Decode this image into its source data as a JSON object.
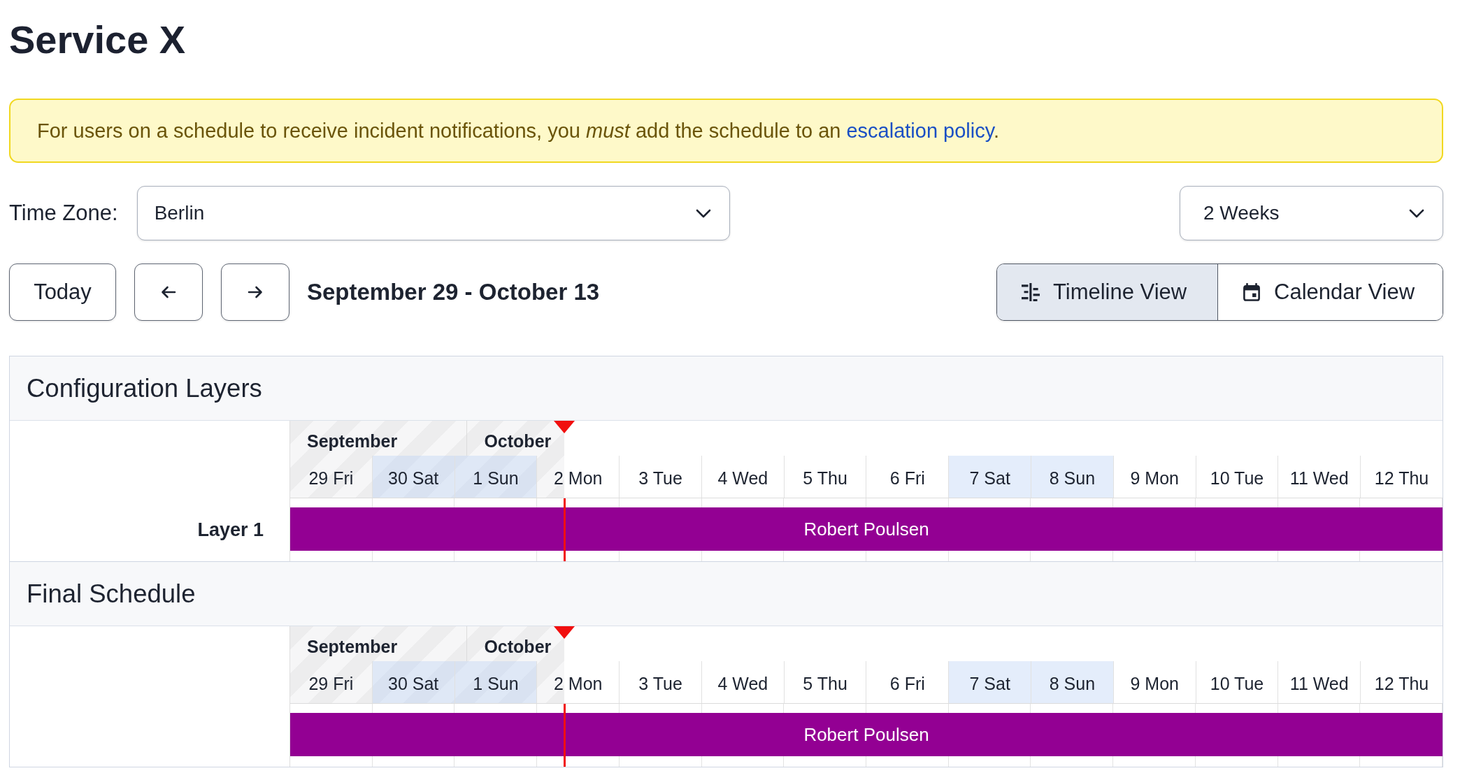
{
  "title": "Service X",
  "notice": {
    "text": "For users on a schedule to receive incident notifications, you *must* add the schedule to an",
    "link": "escalation policy",
    "end": "."
  },
  "time_zone": {
    "label": "Time Zone:",
    "value": "Berlin"
  },
  "range_select": {
    "value": "2 Weeks"
  },
  "nav_buttons": [
    {
      "kind": "text",
      "label": "Today"
    },
    {
      "kind": "prev"
    },
    {
      "kind": "next"
    }
  ],
  "date_range": "September 29 - October 13",
  "view_tabs": [
    {
      "kind": "timeline",
      "label": "Timeline View",
      "selected": true
    },
    {
      "kind": "calendar",
      "label": "Calendar View",
      "selected": false
    }
  ],
  "sections": [
    {
      "title": "Configuration Layers",
      "timeline": {
        "elapsed": {
          "level": 0.238
        },
        "months": [
          {
            "label": "September",
            "days": [
              {
                "label": "29 Fri",
                "weekend": false
              },
              {
                "label": "30 Sat",
                "weekend": true
              }
            ]
          },
          {
            "label": "October",
            "days": [
              {
                "label": "1 Sun",
                "weekend": true
              },
              {
                "label": "2 Mon",
                "weekend": false
              },
              {
                "label": "3 Tue",
                "weekend": false
              },
              {
                "label": "4 Wed",
                "weekend": false
              },
              {
                "label": "5 Thu",
                "weekend": false
              },
              {
                "label": "6 Fri",
                "weekend": false
              },
              {
                "label": "7 Sat",
                "weekend": true
              },
              {
                "label": "8 Sun",
                "weekend": true
              },
              {
                "label": "9 Mon",
                "weekend": false
              },
              {
                "label": "10 Tue",
                "weekend": false
              },
              {
                "label": "11 Wed",
                "weekend": false
              },
              {
                "label": "12 Thu",
                "weekend": false
              }
            ]
          }
        ],
        "rows": [
          {
            "label": "Layer 1",
            "shifts": [
              {
                "name": "Robert Poulsen",
                "color": "#930093"
              }
            ]
          }
        ]
      }
    },
    {
      "title": "Final Schedule",
      "timeline": {
        "elapsed": {
          "level": 0.238
        },
        "months": [
          {
            "label": "September",
            "days": [
              {
                "label": "29 Fri",
                "weekend": false
              },
              {
                "label": "30 Sat",
                "weekend": true
              }
            ]
          },
          {
            "label": "October",
            "days": [
              {
                "label": "1 Sun",
                "weekend": true
              },
              {
                "label": "2 Mon",
                "weekend": false
              },
              {
                "label": "3 Tue",
                "weekend": false
              },
              {
                "label": "4 Wed",
                "weekend": false
              },
              {
                "label": "5 Thu",
                "weekend": false
              },
              {
                "label": "6 Fri",
                "weekend": false
              },
              {
                "label": "7 Sat",
                "weekend": true
              },
              {
                "label": "8 Sun",
                "weekend": true
              },
              {
                "label": "9 Mon",
                "weekend": false
              },
              {
                "label": "10 Tue",
                "weekend": false
              },
              {
                "label": "11 Wed",
                "weekend": false
              },
              {
                "label": "12 Thu",
                "weekend": false
              }
            ]
          }
        ],
        "rows": [
          {
            "shifts": [
              {
                "name": "Robert Poulsen",
                "color": "#930093"
              }
            ]
          }
        ]
      }
    }
  ]
}
